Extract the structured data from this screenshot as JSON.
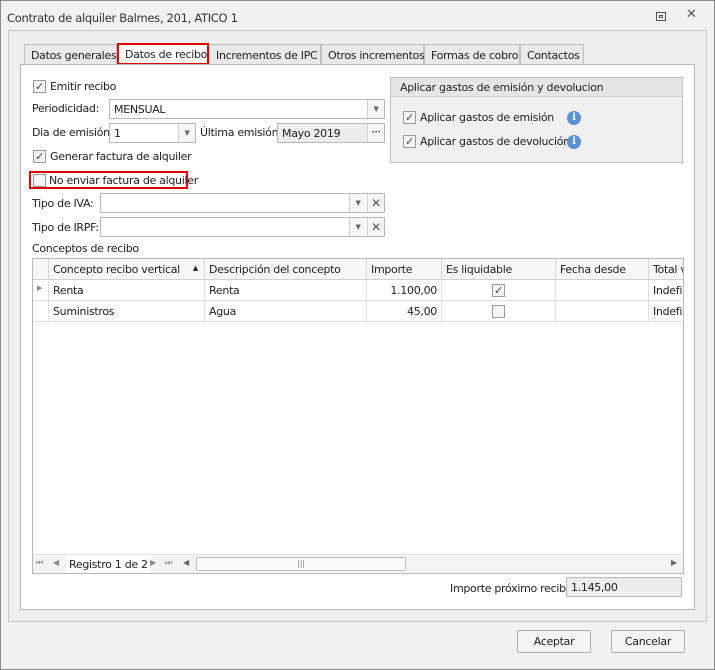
{
  "window": {
    "title": "Contrato de alquiler Balmes, 201, ATICO 1",
    "restore_icon": "restore-icon",
    "close_icon": "close-icon"
  },
  "tabs": [
    {
      "label": "Datos generales"
    },
    {
      "label": "Datos de recibo",
      "active": true
    },
    {
      "label": "Incrementos de IPC"
    },
    {
      "label": "Otros incrementos"
    },
    {
      "label": "Formas de cobro"
    },
    {
      "label": "Contactos"
    }
  ],
  "form": {
    "emitir_recibo": {
      "label": "Emitir recibo",
      "checked": true
    },
    "periodicidad": {
      "label": "Periodicidad:",
      "value": "MENSUAL"
    },
    "dia_emision": {
      "label": "Dia de emisión:",
      "value": "1"
    },
    "ultima_emision": {
      "label": "Última emisión:",
      "value": "Mayo 2019",
      "button": "···"
    },
    "generar_factura": {
      "label": "Generar factura de alquiler",
      "checked": true
    },
    "no_enviar_factura": {
      "label": "No enviar factura de alquiler",
      "checked": false
    },
    "tipo_iva": {
      "label": "Tipo de IVA:",
      "value": ""
    },
    "tipo_irpf": {
      "label": "Tipo de IRPF:",
      "value": ""
    }
  },
  "gastos_group": {
    "title": "Aplicar gastos de emisión y devolucion",
    "items": [
      {
        "label": "Aplicar gastos de emisión",
        "checked": true
      },
      {
        "label": "Aplicar gastos de devolución",
        "checked": true
      }
    ]
  },
  "conceptos": {
    "label": "Conceptos de recibo",
    "columns": [
      "Concepto recibo vertical",
      "Descripción del concepto",
      "Importe",
      "Es liquidable",
      "Fecha desde",
      "Total v"
    ],
    "rows": [
      {
        "concepto": "Renta",
        "descripcion": "Renta",
        "importe": "1.100,00",
        "liquidable": true,
        "fecha": "",
        "total": "Indefi"
      },
      {
        "concepto": "Suministros",
        "descripcion": "Agua",
        "importe": "45,00",
        "liquidable": false,
        "fecha": "",
        "total": "Indefi"
      }
    ],
    "navigator": "Registro 1 de 2"
  },
  "importe_proximo": {
    "label": "Importe próximo recibo",
    "value": "1.145,00"
  },
  "buttons": {
    "accept": "Aceptar",
    "cancel": "Cancelar"
  }
}
